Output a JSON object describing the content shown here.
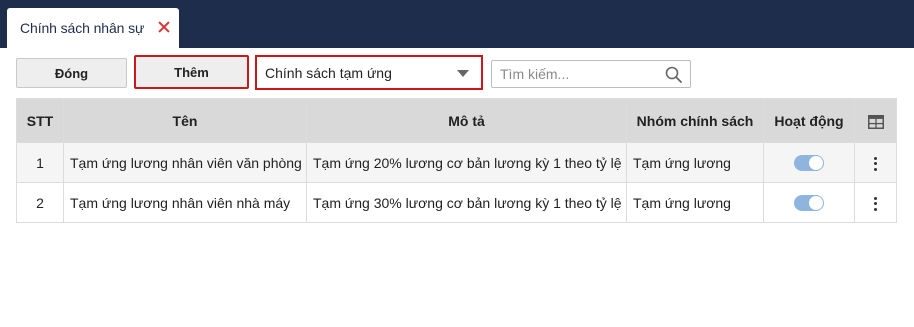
{
  "tab": {
    "title": "Chính sách nhân sự"
  },
  "toolbar": {
    "close_label": "Đóng",
    "add_label": "Thêm",
    "policy_select_value": "Chính sách tạm ứng",
    "search_placeholder": "Tìm kiếm..."
  },
  "table": {
    "headers": {
      "stt": "STT",
      "name": "Tên",
      "description": "Mô tả",
      "group": "Nhóm chính sách",
      "active": "Hoạt động"
    },
    "rows": [
      {
        "stt": "1",
        "name": "Tạm ứng lương nhân viên văn phòng",
        "description": "Tạm ứng 20% lương cơ bản lương kỳ 1 theo tỷ lệ",
        "group": "Tạm ứng lương",
        "active": true
      },
      {
        "stt": "2",
        "name": "Tạm ứng lương nhân viên nhà máy",
        "description": "Tạm ứng 30% lương cơ bản lương kỳ 1 theo tỷ lệ",
        "group": "Tạm ứng lương",
        "active": true
      }
    ]
  },
  "icons": {
    "tab_close": "close-icon",
    "select_caret": "caret-down-icon",
    "search": "search-icon",
    "columns": "table-columns-icon",
    "row_menu": "more-vertical-icon"
  },
  "colors": {
    "topbar": "#1f2d4d",
    "highlight_border": "#d0161c",
    "close_x": "#e03131",
    "toggle_on": "#8fb4de",
    "header_bg": "#d9d9d9"
  }
}
